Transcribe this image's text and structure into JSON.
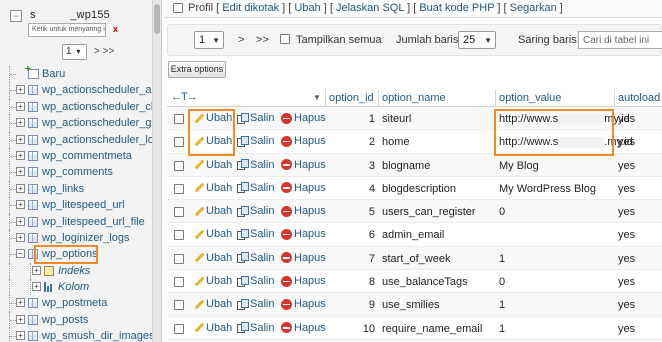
{
  "sidebar": {
    "db_prefix": "s",
    "db_suffix": "_wp155",
    "filter_placeholder": "Ketik untuk menyaring ini",
    "filter_clear": "x",
    "page_value": "1",
    "page_next": "> >>",
    "new_label": "Baru",
    "tables": [
      {
        "label": "wp_actionscheduler_actions"
      },
      {
        "label": "wp_actionscheduler_claims"
      },
      {
        "label": "wp_actionscheduler_groups"
      },
      {
        "label": "wp_actionscheduler_logs"
      },
      {
        "label": "wp_commentmeta"
      },
      {
        "label": "wp_comments"
      },
      {
        "label": "wp_links"
      },
      {
        "label": "wp_litespeed_url"
      },
      {
        "label": "wp_litespeed_url_file"
      },
      {
        "label": "wp_loginizer_logs"
      },
      {
        "label": "wp_options"
      }
    ],
    "subnodes": [
      {
        "label": "Indeks"
      },
      {
        "label": "Kolom"
      }
    ],
    "tables_after": [
      {
        "label": "wp_postmeta"
      },
      {
        "label": "wp_posts"
      },
      {
        "label": "wp_smush_dir_images"
      }
    ]
  },
  "toolbar": {
    "profil": "Profil",
    "links": [
      "Edit dikotak",
      "Ubah",
      "Jelaskan SQL",
      "Buat kode PHP",
      "Segarkan"
    ]
  },
  "nav": {
    "page_select": "1",
    "next": ">",
    "last": ">>",
    "show_all": "Tampilkan semua",
    "rows_label": "Jumlah baris:",
    "rows_value": "25",
    "filter_label": "Saring baris:",
    "filter_placeholder": "Cari di tabel ini"
  },
  "extra_options": "Extra options",
  "table": {
    "columns": [
      "option_id",
      "option_name",
      "option_value",
      "autoload"
    ],
    "action_labels": {
      "edit": "Ubah",
      "copy": "Salin",
      "delete": "Hapus"
    },
    "rows": [
      {
        "option_id": "1",
        "option_name": "siteurl",
        "option_value_pre": "http://www.s",
        "option_value_post": "my.id",
        "autoload": "yes"
      },
      {
        "option_id": "2",
        "option_name": "home",
        "option_value_pre": "http://www.s",
        "option_value_post": ".my.id",
        "autoload": "yes"
      },
      {
        "option_id": "3",
        "option_name": "blogname",
        "option_value_pre": "My Blog",
        "option_value_post": "",
        "autoload": "yes"
      },
      {
        "option_id": "4",
        "option_name": "blogdescription",
        "option_value_pre": "My WordPress Blog",
        "option_value_post": "",
        "autoload": "yes"
      },
      {
        "option_id": "5",
        "option_name": "users_can_register",
        "option_value_pre": "0",
        "option_value_post": "",
        "autoload": "yes"
      },
      {
        "option_id": "6",
        "option_name": "admin_email",
        "option_value_pre": "",
        "option_value_post": "",
        "autoload": "yes"
      },
      {
        "option_id": "7",
        "option_name": "start_of_week",
        "option_value_pre": "1",
        "option_value_post": "",
        "autoload": "yes"
      },
      {
        "option_id": "8",
        "option_name": "use_balanceTags",
        "option_value_pre": "0",
        "option_value_post": "",
        "autoload": "yes"
      },
      {
        "option_id": "9",
        "option_name": "use_smilies",
        "option_value_pre": "1",
        "option_value_post": "",
        "autoload": "yes"
      },
      {
        "option_id": "10",
        "option_name": "require_name_email",
        "option_value_pre": "1",
        "option_value_post": "",
        "autoload": "yes"
      }
    ]
  },
  "colors": {
    "link": "#235a81",
    "highlight": "#f08a24",
    "delete": "#d9342b"
  }
}
